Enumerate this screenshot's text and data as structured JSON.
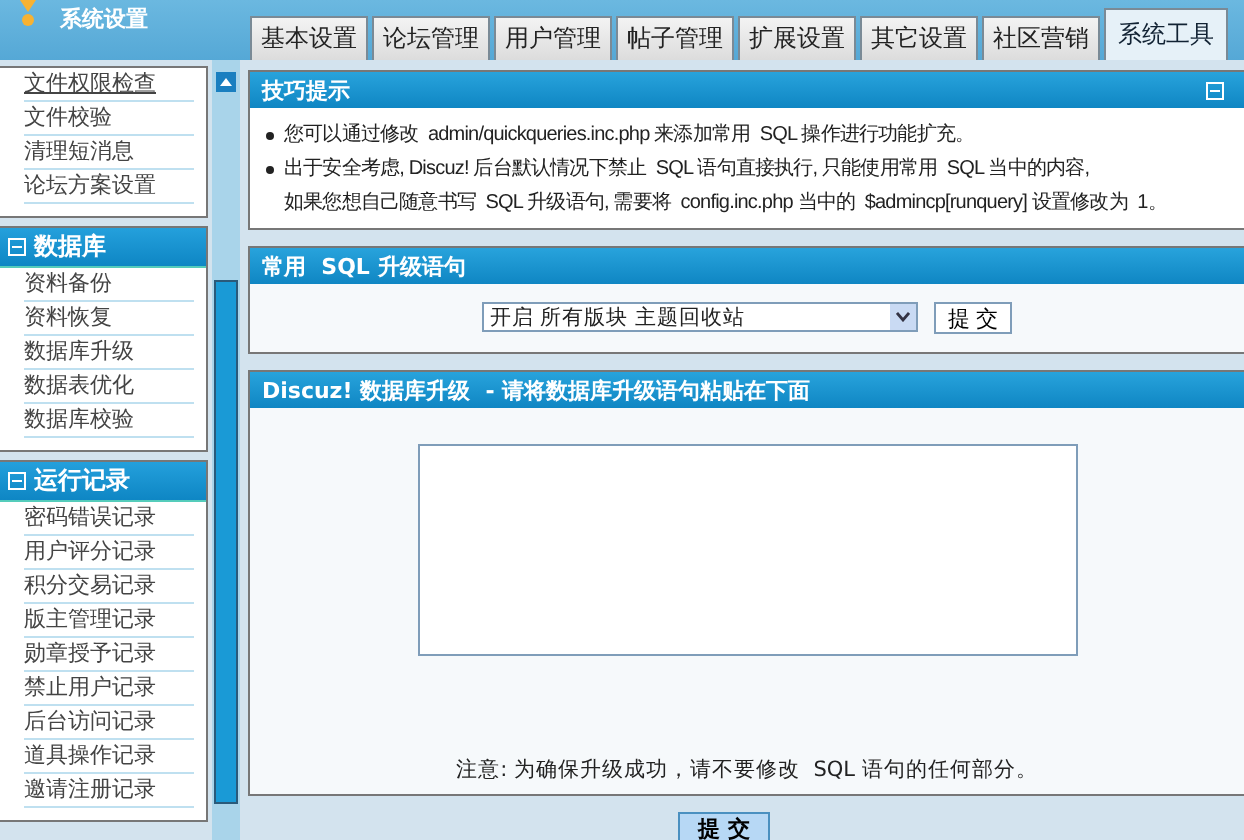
{
  "header": {
    "title": "系统设置"
  },
  "tabs": [
    {
      "label": "基本设置",
      "selected": false
    },
    {
      "label": "论坛管理",
      "selected": false
    },
    {
      "label": "用户管理",
      "selected": false
    },
    {
      "label": "帖子管理",
      "selected": false
    },
    {
      "label": "扩展设置",
      "selected": false
    },
    {
      "label": "其它设置",
      "selected": false
    },
    {
      "label": "社区营销",
      "selected": false
    },
    {
      "label": "系统工具",
      "selected": true
    }
  ],
  "sidebar": {
    "top_items": [
      "文件权限检查",
      "文件校验",
      "清理短消息",
      "论坛方案设置"
    ],
    "sections": [
      {
        "title": "数据库",
        "expanded": true,
        "items": [
          "资料备份",
          "资料恢复",
          "数据库升级",
          "数据表优化",
          "数据库校验"
        ]
      },
      {
        "title": "运行记录",
        "expanded": true,
        "items": [
          "密码错误记录",
          "用户评分记录",
          "积分交易记录",
          "版主管理记录",
          "勋章授予记录",
          "禁止用户记录",
          "后台访问记录",
          "道具操作记录",
          "邀请注册记录"
        ]
      }
    ]
  },
  "tips_panel": {
    "title": "技巧提示",
    "expanded": true,
    "items": [
      {
        "lines": [
          "您可以通过修改  admin/quickqueries.inc.php 来添加常用  SQL 操作进行功能扩充。"
        ]
      },
      {
        "lines": [
          "出于安全考虑, Discuz! 后台默认情况下禁止  SQL 语句直接执行, 只能使用常用  SQL 当中的内容,",
          "如果您想自己随意书写  SQL 升级语句, 需要将  config.inc.php 当中的  $admincp[runquery] 设置修改为  1。"
        ]
      }
    ]
  },
  "sql_panel": {
    "title": "常用  SQL 升级语句",
    "select_value": "开启 所有版块 主题回收站",
    "button": "提 交"
  },
  "upgrade_panel": {
    "title": "Discuz! 数据库升级  - 请将数据库升级语句粘贴在下面",
    "note": "注意: 为确保升级成功，请不要修改  SQL 语句的任何部分。"
  },
  "submit_button": "提 交"
}
